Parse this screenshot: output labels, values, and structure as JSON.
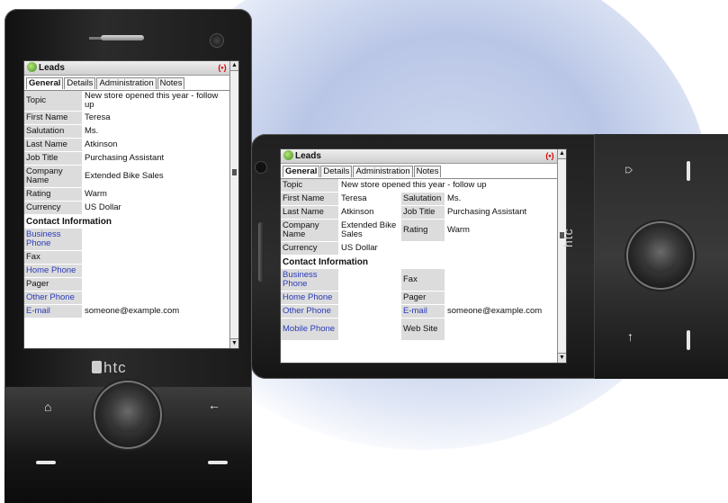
{
  "header": {
    "title": "Leads"
  },
  "tabs": [
    "General",
    "Details",
    "Administration",
    "Notes"
  ],
  "fields": {
    "topic": {
      "label": "Topic",
      "value": "New store opened this year - follow up"
    },
    "first_name": {
      "label": "First Name",
      "value": "Teresa"
    },
    "salutation": {
      "label": "Salutation",
      "value": "Ms."
    },
    "last_name": {
      "label": "Last Name",
      "value": "Atkinson"
    },
    "job_title": {
      "label": "Job Title",
      "value": "Purchasing Assistant"
    },
    "company_name": {
      "label": "Company Name",
      "value": "Extended Bike Sales"
    },
    "rating": {
      "label": "Rating",
      "value": "Warm"
    },
    "currency": {
      "label": "Currency",
      "value": "US Dollar"
    }
  },
  "contact": {
    "section_title": "Contact Information",
    "business_phone": "Business Phone",
    "fax": "Fax",
    "home_phone": "Home Phone",
    "pager": "Pager",
    "other_phone": "Other Phone",
    "email_label": "E-mail",
    "email_value": "someone@example.com",
    "mobile_phone": "Mobile Phone",
    "web_site": "Web Site"
  },
  "device": {
    "brand": "htc"
  },
  "icons": [
    "home-icon",
    "back-arrow-icon",
    "call-icon",
    "end-call-icon",
    "leads-icon",
    "record-icon",
    "scroll-up-icon",
    "scroll-down-icon"
  ]
}
